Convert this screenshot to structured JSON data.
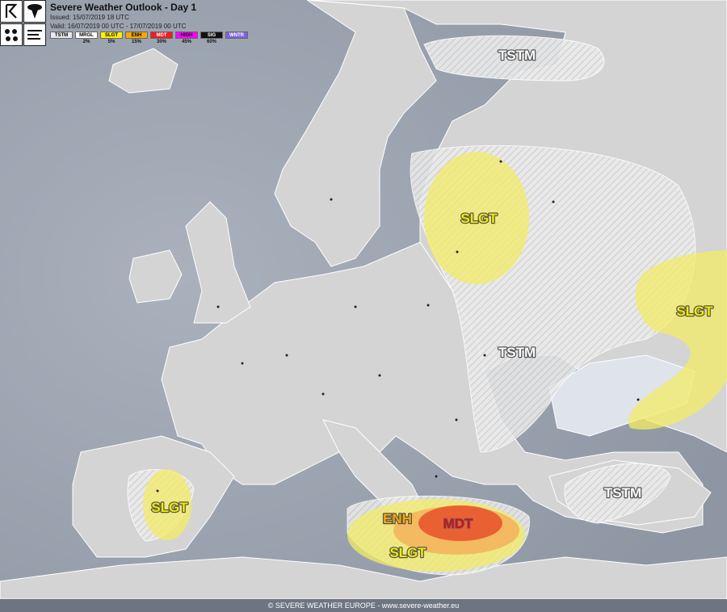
{
  "header": {
    "title": "Severe Weather Outlook - Day 1",
    "issued": "Issued: 15/07/2019 18 UTC",
    "valid": "Valid: 16/07/2019 00 UTC - 17/07/2019 00 UTC"
  },
  "legend": [
    {
      "label": "TSTM",
      "pct": "",
      "color": "#e9e9e9"
    },
    {
      "label": "MRGL",
      "pct": "2%",
      "color": "#ffffff"
    },
    {
      "label": "SLGT",
      "pct": "5%",
      "color": "#fff200"
    },
    {
      "label": "ENH",
      "pct": "15%",
      "color": "#f7a800"
    },
    {
      "label": "MDT",
      "pct": "30%",
      "color": "#ee1c24"
    },
    {
      "label": "HIGH",
      "pct": "45%",
      "color": "#ff00ff"
    },
    {
      "label": "SIG",
      "pct": "60%",
      "color": "#111111"
    },
    {
      "label": "WNTR",
      "pct": "",
      "color": "#7f63e0"
    }
  ],
  "labels": {
    "tstm_north": "TSTM",
    "slgt_baltic": "SLGT",
    "tstm_central": "TSTM",
    "slgt_east": "SLGT",
    "tstm_turkey": "TSTM",
    "slgt_spain": "SLGT",
    "enh_south": "ENH",
    "mdt_south": "MDT",
    "slgt_south": "SLGT"
  },
  "colors": {
    "sea": "#9ea6b2",
    "land": "#d3d3d3",
    "slgt": "#f3ec66",
    "enh": "#f3c25a",
    "mdt": "#e8562f"
  },
  "footer": "© SEVERE WEATHER EUROPE - www.severe-weather.eu"
}
